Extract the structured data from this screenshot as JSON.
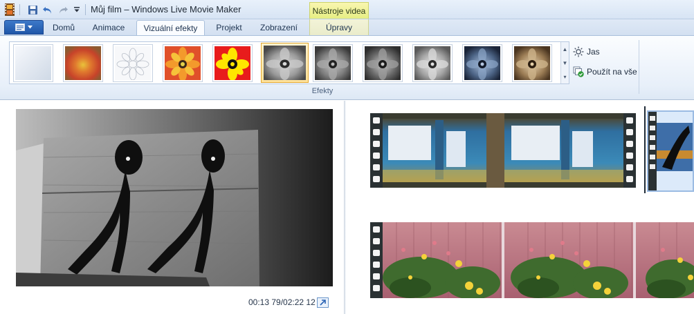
{
  "window": {
    "title": "Můj film – Windows Live Movie Maker",
    "context_tab_header": "Nástroje videa"
  },
  "quick_access": {
    "icons": [
      "app-filmstrip-icon",
      "save-icon",
      "undo-icon",
      "redo-icon",
      "customize-dropdown-icon"
    ]
  },
  "tabs": [
    {
      "label": "Domů",
      "active": false
    },
    {
      "label": "Animace",
      "active": false
    },
    {
      "label": "Vizuální efekty",
      "active": true
    },
    {
      "label": "Projekt",
      "active": false
    },
    {
      "label": "Zobrazení",
      "active": false
    },
    {
      "label": "Úpravy",
      "active": false,
      "contextual": true
    }
  ],
  "ribbon": {
    "effects_group_label": "Efekty",
    "effects": [
      {
        "icon": "no-effect-icon"
      },
      {
        "icon": "blur-effect-icon"
      },
      {
        "icon": "edge-detect-effect-icon"
      },
      {
        "icon": "posterize-effect-icon"
      },
      {
        "icon": "threshold-effect-icon"
      },
      {
        "icon": "black-white-effect-icon",
        "selected": true
      },
      {
        "icon": "black-white-red-filter-icon"
      },
      {
        "icon": "black-white-yellow-filter-icon"
      },
      {
        "icon": "black-white-orange-filter-icon"
      },
      {
        "icon": "cyanotype-effect-icon"
      },
      {
        "icon": "sepia-effect-icon"
      }
    ],
    "brightness_label": "Jas",
    "apply_all_label": "Použít na vše"
  },
  "preview": {
    "timecode": "00:13 79/02:22 12"
  },
  "colors": {
    "accent_blue": "#1f56a8",
    "selection_orange": "#e0a52d",
    "context_tab_yellow": "#e6ee83"
  }
}
